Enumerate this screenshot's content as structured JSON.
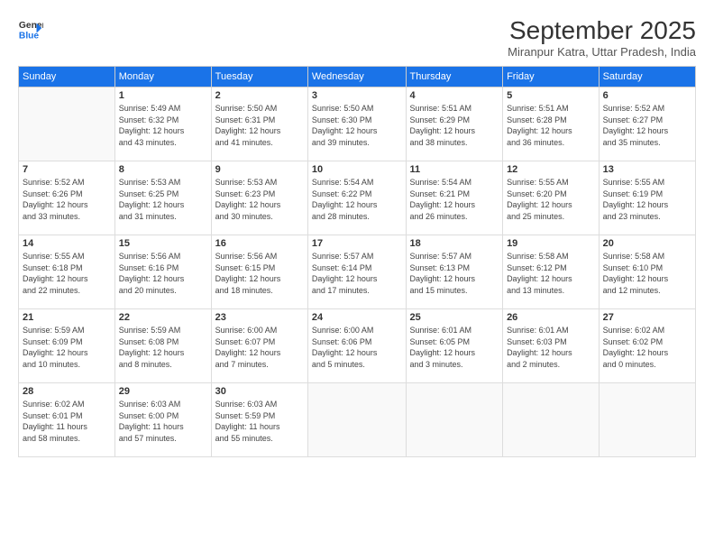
{
  "header": {
    "logo_line1": "General",
    "logo_line2": "Blue",
    "month_title": "September 2025",
    "location": "Miranpur Katra, Uttar Pradesh, India"
  },
  "weekdays": [
    "Sunday",
    "Monday",
    "Tuesday",
    "Wednesday",
    "Thursday",
    "Friday",
    "Saturday"
  ],
  "weeks": [
    [
      {
        "day": "",
        "info": ""
      },
      {
        "day": "1",
        "info": "Sunrise: 5:49 AM\nSunset: 6:32 PM\nDaylight: 12 hours\nand 43 minutes."
      },
      {
        "day": "2",
        "info": "Sunrise: 5:50 AM\nSunset: 6:31 PM\nDaylight: 12 hours\nand 41 minutes."
      },
      {
        "day": "3",
        "info": "Sunrise: 5:50 AM\nSunset: 6:30 PM\nDaylight: 12 hours\nand 39 minutes."
      },
      {
        "day": "4",
        "info": "Sunrise: 5:51 AM\nSunset: 6:29 PM\nDaylight: 12 hours\nand 38 minutes."
      },
      {
        "day": "5",
        "info": "Sunrise: 5:51 AM\nSunset: 6:28 PM\nDaylight: 12 hours\nand 36 minutes."
      },
      {
        "day": "6",
        "info": "Sunrise: 5:52 AM\nSunset: 6:27 PM\nDaylight: 12 hours\nand 35 minutes."
      }
    ],
    [
      {
        "day": "7",
        "info": "Sunrise: 5:52 AM\nSunset: 6:26 PM\nDaylight: 12 hours\nand 33 minutes."
      },
      {
        "day": "8",
        "info": "Sunrise: 5:53 AM\nSunset: 6:25 PM\nDaylight: 12 hours\nand 31 minutes."
      },
      {
        "day": "9",
        "info": "Sunrise: 5:53 AM\nSunset: 6:23 PM\nDaylight: 12 hours\nand 30 minutes."
      },
      {
        "day": "10",
        "info": "Sunrise: 5:54 AM\nSunset: 6:22 PM\nDaylight: 12 hours\nand 28 minutes."
      },
      {
        "day": "11",
        "info": "Sunrise: 5:54 AM\nSunset: 6:21 PM\nDaylight: 12 hours\nand 26 minutes."
      },
      {
        "day": "12",
        "info": "Sunrise: 5:55 AM\nSunset: 6:20 PM\nDaylight: 12 hours\nand 25 minutes."
      },
      {
        "day": "13",
        "info": "Sunrise: 5:55 AM\nSunset: 6:19 PM\nDaylight: 12 hours\nand 23 minutes."
      }
    ],
    [
      {
        "day": "14",
        "info": "Sunrise: 5:55 AM\nSunset: 6:18 PM\nDaylight: 12 hours\nand 22 minutes."
      },
      {
        "day": "15",
        "info": "Sunrise: 5:56 AM\nSunset: 6:16 PM\nDaylight: 12 hours\nand 20 minutes."
      },
      {
        "day": "16",
        "info": "Sunrise: 5:56 AM\nSunset: 6:15 PM\nDaylight: 12 hours\nand 18 minutes."
      },
      {
        "day": "17",
        "info": "Sunrise: 5:57 AM\nSunset: 6:14 PM\nDaylight: 12 hours\nand 17 minutes."
      },
      {
        "day": "18",
        "info": "Sunrise: 5:57 AM\nSunset: 6:13 PM\nDaylight: 12 hours\nand 15 minutes."
      },
      {
        "day": "19",
        "info": "Sunrise: 5:58 AM\nSunset: 6:12 PM\nDaylight: 12 hours\nand 13 minutes."
      },
      {
        "day": "20",
        "info": "Sunrise: 5:58 AM\nSunset: 6:10 PM\nDaylight: 12 hours\nand 12 minutes."
      }
    ],
    [
      {
        "day": "21",
        "info": "Sunrise: 5:59 AM\nSunset: 6:09 PM\nDaylight: 12 hours\nand 10 minutes."
      },
      {
        "day": "22",
        "info": "Sunrise: 5:59 AM\nSunset: 6:08 PM\nDaylight: 12 hours\nand 8 minutes."
      },
      {
        "day": "23",
        "info": "Sunrise: 6:00 AM\nSunset: 6:07 PM\nDaylight: 12 hours\nand 7 minutes."
      },
      {
        "day": "24",
        "info": "Sunrise: 6:00 AM\nSunset: 6:06 PM\nDaylight: 12 hours\nand 5 minutes."
      },
      {
        "day": "25",
        "info": "Sunrise: 6:01 AM\nSunset: 6:05 PM\nDaylight: 12 hours\nand 3 minutes."
      },
      {
        "day": "26",
        "info": "Sunrise: 6:01 AM\nSunset: 6:03 PM\nDaylight: 12 hours\nand 2 minutes."
      },
      {
        "day": "27",
        "info": "Sunrise: 6:02 AM\nSunset: 6:02 PM\nDaylight: 12 hours\nand 0 minutes."
      }
    ],
    [
      {
        "day": "28",
        "info": "Sunrise: 6:02 AM\nSunset: 6:01 PM\nDaylight: 11 hours\nand 58 minutes."
      },
      {
        "day": "29",
        "info": "Sunrise: 6:03 AM\nSunset: 6:00 PM\nDaylight: 11 hours\nand 57 minutes."
      },
      {
        "day": "30",
        "info": "Sunrise: 6:03 AM\nSunset: 5:59 PM\nDaylight: 11 hours\nand 55 minutes."
      },
      {
        "day": "",
        "info": ""
      },
      {
        "day": "",
        "info": ""
      },
      {
        "day": "",
        "info": ""
      },
      {
        "day": "",
        "info": ""
      }
    ]
  ]
}
